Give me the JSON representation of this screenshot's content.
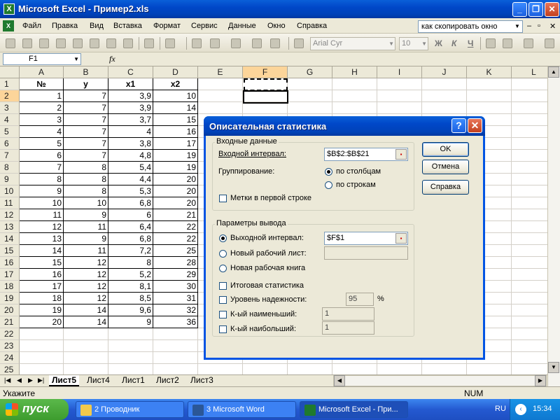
{
  "window": {
    "title": "Microsoft Excel - Пример2.xls",
    "app_icon": "excel-icon",
    "minimize": "_",
    "restore": "❐",
    "close": "✕"
  },
  "menu": {
    "items": [
      "Файл",
      "Правка",
      "Вид",
      "Вставка",
      "Формат",
      "Сервис",
      "Данные",
      "Окно",
      "Справка"
    ],
    "help_box": "как скопировать окно",
    "mdi_buttons": [
      "–",
      "▫",
      "✕"
    ]
  },
  "toolbar": {
    "font_name": "Arial Cyr",
    "font_size": "10",
    "bold": "Ж",
    "italic": "К",
    "underline": "Ч"
  },
  "formula_bar": {
    "name_box": "F1",
    "fx": "fx",
    "value": ""
  },
  "sheet": {
    "columns": [
      "A",
      "B",
      "C",
      "D",
      "E",
      "F",
      "G",
      "H",
      "I",
      "J",
      "K",
      "L"
    ],
    "active_column": "F",
    "active_row": 2,
    "row_count": 25,
    "header": [
      "№",
      "y",
      "x1",
      "x2"
    ],
    "rows": [
      [
        "1",
        "7",
        "3,9",
        "10"
      ],
      [
        "2",
        "7",
        "3,9",
        "14"
      ],
      [
        "3",
        "7",
        "3,7",
        "15"
      ],
      [
        "4",
        "7",
        "4",
        "16"
      ],
      [
        "5",
        "7",
        "3,8",
        "17"
      ],
      [
        "6",
        "7",
        "4,8",
        "19"
      ],
      [
        "7",
        "8",
        "5,4",
        "19"
      ],
      [
        "8",
        "8",
        "4,4",
        "20"
      ],
      [
        "9",
        "8",
        "5,3",
        "20"
      ],
      [
        "10",
        "10",
        "6,8",
        "20"
      ],
      [
        "11",
        "9",
        "6",
        "21"
      ],
      [
        "12",
        "11",
        "6,4",
        "22"
      ],
      [
        "13",
        "9",
        "6,8",
        "22"
      ],
      [
        "14",
        "11",
        "7,2",
        "25"
      ],
      [
        "15",
        "12",
        "8",
        "28"
      ],
      [
        "16",
        "12",
        "5,2",
        "29"
      ],
      [
        "17",
        "12",
        "8,1",
        "30"
      ],
      [
        "18",
        "12",
        "8,5",
        "31"
      ],
      [
        "19",
        "14",
        "9,6",
        "32"
      ],
      [
        "20",
        "14",
        "9",
        "36"
      ]
    ]
  },
  "tabs": {
    "sheets": [
      "Лист5",
      "Лист4",
      "Лист1",
      "Лист2",
      "Лист3"
    ],
    "active": "Лист5",
    "nav": [
      "|◀",
      "◀",
      "▶",
      "▶|"
    ]
  },
  "status": {
    "mode": "Укажите",
    "num": "NUM"
  },
  "dialog": {
    "title": "Описательная статистика",
    "help_btn": "?",
    "close_btn": "✕",
    "input_group": "Входные данные",
    "input_range_label": "Входной интервал:",
    "input_range_value": "$B$2:$B$21",
    "grouping_label": "Группирование:",
    "by_columns": "по столбцам",
    "by_rows": "по строкам",
    "labels_first_row": "Метки в первой строке",
    "output_group": "Параметры вывода",
    "output_range_label": "Выходной интервал:",
    "output_range_value": "$F$1",
    "new_sheet_label": "Новый рабочий лист:",
    "new_sheet_value": "",
    "new_workbook_label": "Новая рабочая книга",
    "summary_stats": "Итоговая статистика",
    "confidence_label": "Уровень надежности:",
    "confidence_value": "95",
    "confidence_unit": "%",
    "kth_smallest_label": "К-ый наименьший:",
    "kth_smallest_value": "1",
    "kth_largest_label": "К-ый наибольший:",
    "kth_largest_value": "1",
    "ok": "OK",
    "cancel": "Отмена",
    "help": "Справка"
  },
  "taskbar": {
    "start": "пуск",
    "tasks": [
      "2 Проводник",
      "3 Microsoft Word",
      "Microsoft Excel - При..."
    ],
    "lang": "RU",
    "clock": "15:34"
  }
}
